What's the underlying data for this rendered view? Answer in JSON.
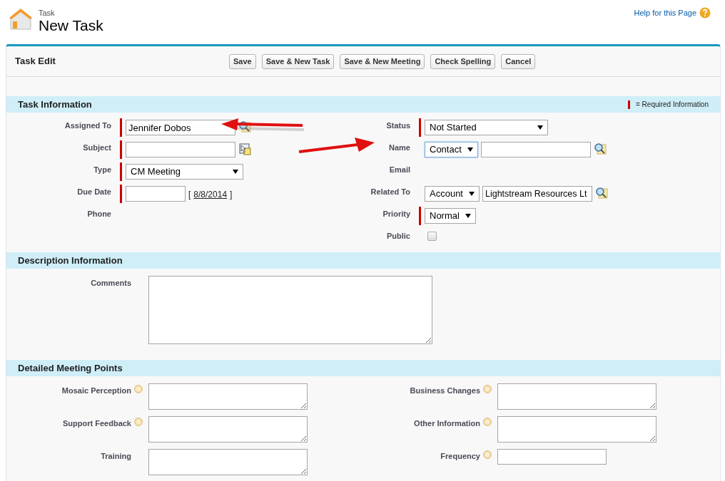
{
  "header": {
    "object": "Task",
    "title": "New Task",
    "help": "Help for this Page"
  },
  "toolbar": {
    "title": "Task Edit",
    "buttons": [
      "Save",
      "Save & New Task",
      "Save & New Meeting",
      "Check Spelling",
      "Cancel"
    ]
  },
  "sections": [
    {
      "kind": "two_column",
      "title": "Task Information",
      "legend": "= Required Information",
      "left": [
        {
          "label": "Assigned To",
          "kind": "lookup",
          "required": true,
          "value": "Jennifer Dobos",
          "arrow": true
        },
        {
          "label": "Subject",
          "kind": "combo",
          "required": true
        },
        {
          "label": "Type",
          "kind": "select",
          "required": true,
          "value": "CM Meeting"
        },
        {
          "label": "Due Date",
          "kind": "date",
          "required": true,
          "date_link": "8/8/2014",
          "brackets": [
            "[",
            "]"
          ]
        },
        {
          "label": "Phone",
          "kind": "none",
          "required": false
        }
      ],
      "right": [
        {
          "label": "Status",
          "kind": "select",
          "required": true,
          "value": "Not Started"
        },
        {
          "label": "Name",
          "kind": "typed_lookup",
          "required": false,
          "select": "Contact",
          "focused": true,
          "arrow": true
        },
        {
          "label": "Email",
          "kind": "none",
          "required": false
        },
        {
          "label": "Related To",
          "kind": "typed_lookup",
          "required": false,
          "select": "Account",
          "focused": false,
          "value": "Lightstream Resources Lt"
        },
        {
          "label": "Priority",
          "kind": "select",
          "required": true,
          "value": "Normal"
        },
        {
          "label": "Public",
          "kind": "checkbox",
          "required": false,
          "checked": false
        }
      ]
    },
    {
      "kind": "wide",
      "title": "Description Information",
      "fields": [
        {
          "label": "Comments",
          "kind": "textarea",
          "help": false
        }
      ]
    },
    {
      "kind": "pairs",
      "title": "Detailed Meeting Points",
      "left": [
        {
          "label": "Mosaic Perception",
          "kind": "textarea",
          "help": true
        },
        {
          "label": "Support Feedback",
          "kind": "textarea",
          "help": true
        },
        {
          "label": "Training",
          "kind": "textarea",
          "help": false
        }
      ],
      "right": [
        {
          "label": "Business Changes",
          "kind": "textarea",
          "help": true
        },
        {
          "label": "Other Information",
          "kind": "textarea",
          "help": true
        },
        {
          "label": "Frequency",
          "kind": "text",
          "help": true
        }
      ]
    }
  ]
}
